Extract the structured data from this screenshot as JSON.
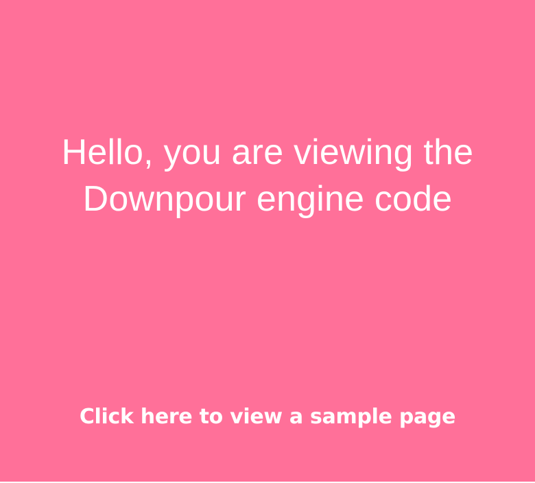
{
  "page": {
    "background_color": "#ff7099",
    "text_color": "#ffffff"
  },
  "headline": {
    "line1": "Hello, you are viewing the",
    "line2": "Downpour engine code"
  },
  "link": {
    "label": "Click here to view a sample page"
  }
}
